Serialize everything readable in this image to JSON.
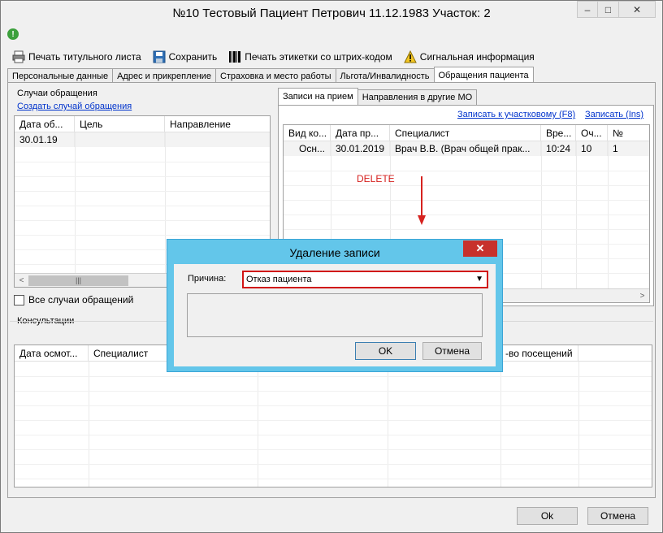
{
  "window": {
    "title": "№10 Тестовый Пациент Петрович 11.12.1983 Участок: 2",
    "controls": {
      "minimize": "–",
      "maximize": "□",
      "close": "✕"
    }
  },
  "toolbar": {
    "print_title": "Печать титульного листа",
    "save": "Сохранить",
    "print_barcode": "Печать этикетки со штрих-кодом",
    "signal_info": "Сигнальная информация"
  },
  "tabs": [
    "Персональные данные",
    "Адрес и прикрепление",
    "Страховка и место работы",
    "Льгота/Инвалидность",
    "Обращения пациента"
  ],
  "cases": {
    "group_label": "Случаи обращения",
    "create_link": "Создать случай обращения",
    "columns": [
      "Дата об...",
      "Цель",
      "Направление"
    ],
    "rows": [
      [
        "30.01.19",
        "",
        ""
      ]
    ],
    "all_cases_label": "Все случаи обращений"
  },
  "appointments": {
    "tabs": [
      "Записи на прием",
      "Направления в другие МО"
    ],
    "link_district": "Записать к участковому (F8)",
    "link_record": "Записать (Ins)",
    "columns": [
      "Вид ко...",
      "Дата пр...",
      "Специалист",
      "Вре...",
      "Оч...",
      "№"
    ],
    "rows": [
      [
        "Осн...",
        "30.01.2019",
        "Врач В.В. (Врач общей прак...",
        "10:24",
        "10",
        "1"
      ]
    ]
  },
  "consultations": {
    "group_label": "Консультации",
    "columns": [
      "Дата осмот...",
      "Специалист",
      "",
      "",
      "",
      "-во посещений",
      ""
    ]
  },
  "annotation": "DELETE",
  "footer": {
    "ok": "Ok",
    "cancel": "Отмена"
  },
  "dialog": {
    "title": "Удаление записи",
    "reason_label": "Причина:",
    "reason_value": "Отказ пациента",
    "ok": "OK",
    "cancel": "Отмена"
  },
  "colors": {
    "dialog_frame": "#63c6ea",
    "close_button": "#c7312c",
    "highlight": "#d11414",
    "link": "#0033cc"
  }
}
